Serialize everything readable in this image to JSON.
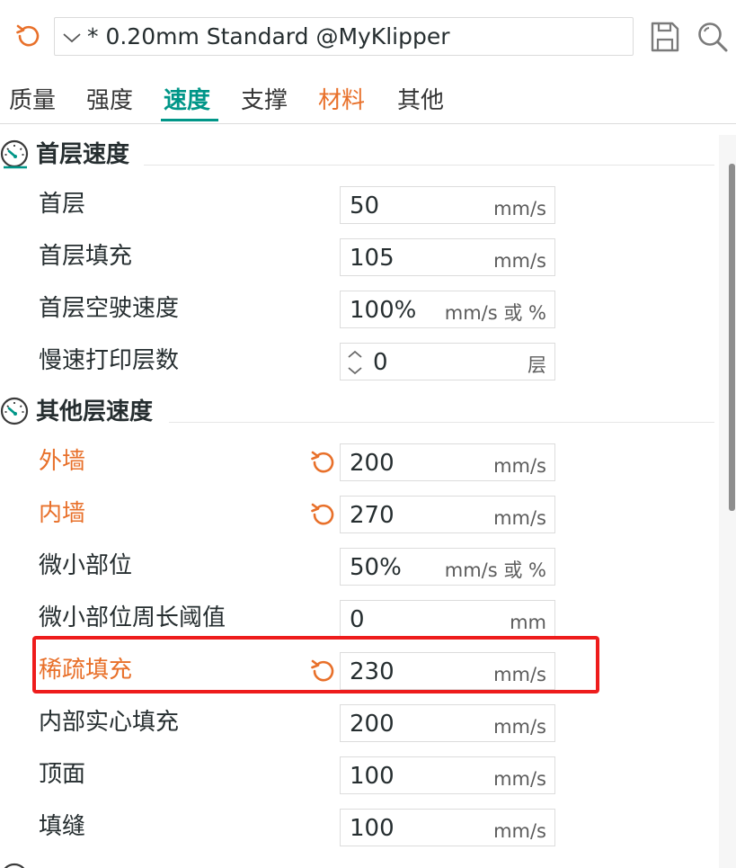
{
  "preset": {
    "value": "* 0.20mm Standard @MyKlipper"
  },
  "tabs": [
    {
      "label": "质量",
      "state": "normal"
    },
    {
      "label": "强度",
      "state": "normal"
    },
    {
      "label": "速度",
      "state": "active"
    },
    {
      "label": "支撑",
      "state": "normal"
    },
    {
      "label": "材料",
      "state": "modified"
    },
    {
      "label": "其他",
      "state": "normal"
    }
  ],
  "sections": {
    "first_layer": {
      "title": "首层速度",
      "rows": [
        {
          "label": "首层",
          "value": "50",
          "unit": "mm/s"
        },
        {
          "label": "首层填充",
          "value": "105",
          "unit": "mm/s"
        },
        {
          "label": "首层空驶速度",
          "value": "100%",
          "unit": "mm/s 或 %"
        },
        {
          "label": "慢速打印层数",
          "value": "0",
          "unit": "层"
        }
      ]
    },
    "other_layers": {
      "title": "其他层速度",
      "rows": [
        {
          "label": "外墙",
          "value": "200",
          "unit": "mm/s",
          "modified": true
        },
        {
          "label": "内墙",
          "value": "270",
          "unit": "mm/s",
          "modified": true
        },
        {
          "label": "微小部位",
          "value": "50%",
          "unit": "mm/s 或 %"
        },
        {
          "label": "微小部位周长阈值",
          "value": "0",
          "unit": "mm"
        },
        {
          "label": "稀疏填充",
          "value": "230",
          "unit": "mm/s",
          "modified": true
        },
        {
          "label": "内部实心填充",
          "value": "200",
          "unit": "mm/s"
        },
        {
          "label": "顶面",
          "value": "100",
          "unit": "mm/s"
        },
        {
          "label": "填缝",
          "value": "100",
          "unit": "mm/s"
        }
      ]
    }
  },
  "icons": {
    "reset": "undo-arrow-icon",
    "dropdown": "chevron-down-icon",
    "save": "save-icon",
    "search": "search-icon",
    "section": "speedometer-icon",
    "spin": "spinner-arrows-icon"
  },
  "colors": {
    "accent": "#009688",
    "modified": "#e8702a",
    "highlight": "#ee1c1c"
  }
}
